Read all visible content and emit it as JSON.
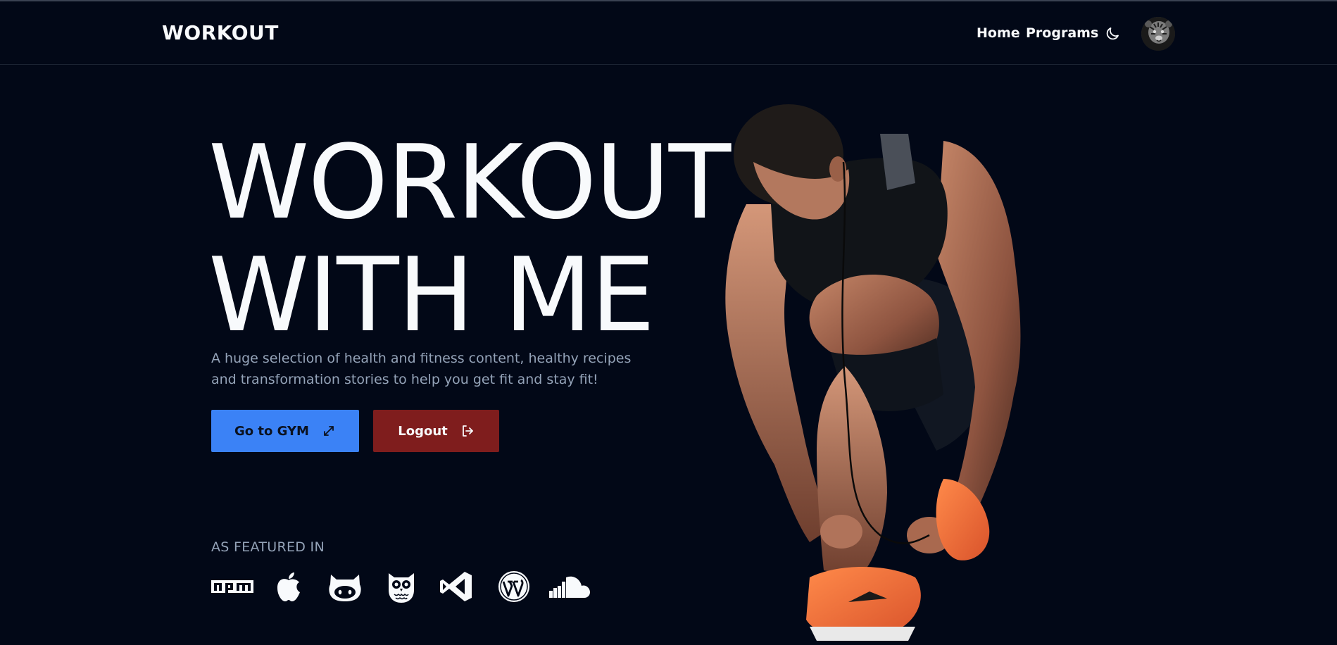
{
  "navbar": {
    "brand": "WORKOUT",
    "links": [
      {
        "label": "Home"
      },
      {
        "label": "Programs"
      }
    ],
    "theme_toggle_icon": "moon-icon",
    "avatar_icon": "tiger-avatar"
  },
  "hero": {
    "title_line1": "WORKOUT",
    "title_line2": "WITH ME",
    "subtitle": "A huge selection of health and fitness content, healthy recipes and transformation stories to help you get fit and stay fit!",
    "image": "athlete-tying-shoe-photo"
  },
  "buttons": {
    "gym": {
      "label": "Go to GYM",
      "icon": "arrows-expand-icon",
      "color": "#3b82f6"
    },
    "logout": {
      "label": "Logout",
      "icon": "logout-icon",
      "color": "#7f1d1d"
    }
  },
  "featured": {
    "label": "AS FEATURED IN",
    "logos": [
      "npm-logo",
      "apple-logo",
      "github-logo",
      "hootsuite-logo",
      "vscode-logo",
      "wordpress-logo",
      "soundcloud-logo"
    ]
  },
  "colors": {
    "background": "#020817",
    "text": "#f8fafc",
    "muted": "#94a3b8",
    "primary": "#3b82f6",
    "danger": "#7f1d1d"
  }
}
